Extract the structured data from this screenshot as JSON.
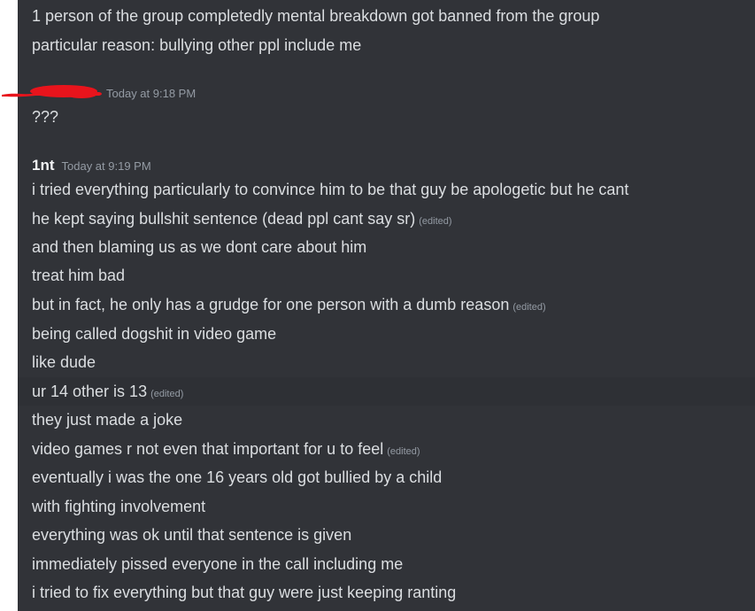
{
  "messages_top": [
    {
      "text": "1 person of the group completedly mental breakdown got banned from the group",
      "edited": ""
    },
    {
      "text": "particular reason: bullying other ppl include me",
      "edited": ""
    }
  ],
  "msg2": {
    "timestamp": "Today at 9:18 PM",
    "text": "???"
  },
  "msg3": {
    "author": "1nt",
    "timestamp": "Today at 9:19 PM",
    "lines": [
      {
        "text": "i tried everything particularly to convince him to be that guy be apologetic but he cant",
        "edited": ""
      },
      {
        "text": "he kept saying bullshit sentence (dead ppl cant say sr)",
        "edited": "(edited)"
      },
      {
        "text": "and then blaming us as we dont care about him",
        "edited": ""
      },
      {
        "text": "treat him bad",
        "edited": ""
      },
      {
        "text": "but in fact, he only has a grudge for one person with a dumb reason",
        "edited": "(edited)"
      },
      {
        "text": "being called dogshit in video game",
        "edited": ""
      },
      {
        "text": "like dude",
        "edited": ""
      },
      {
        "text": "ur 14 other is 13",
        "edited": "(edited)"
      },
      {
        "text": "they just made a joke",
        "edited": ""
      },
      {
        "text": "video games r not even that important for u to feel",
        "edited": "(edited)"
      },
      {
        "text": "eventually i was the one 16 years old got bullied by a child",
        "edited": ""
      },
      {
        "text": "with fighting involvement",
        "edited": ""
      },
      {
        "text": "everything was ok until that sentence is given",
        "edited": ""
      },
      {
        "text": "immediately pissed everyone in the call including me",
        "edited": ""
      },
      {
        "text": "i tried to fix everything but that guy were just keeping ranting",
        "edited": ""
      }
    ]
  },
  "colors": {
    "background": "#313338",
    "text": "#dbdee1",
    "muted": "#949ba4",
    "redaction": "#e8141c"
  }
}
